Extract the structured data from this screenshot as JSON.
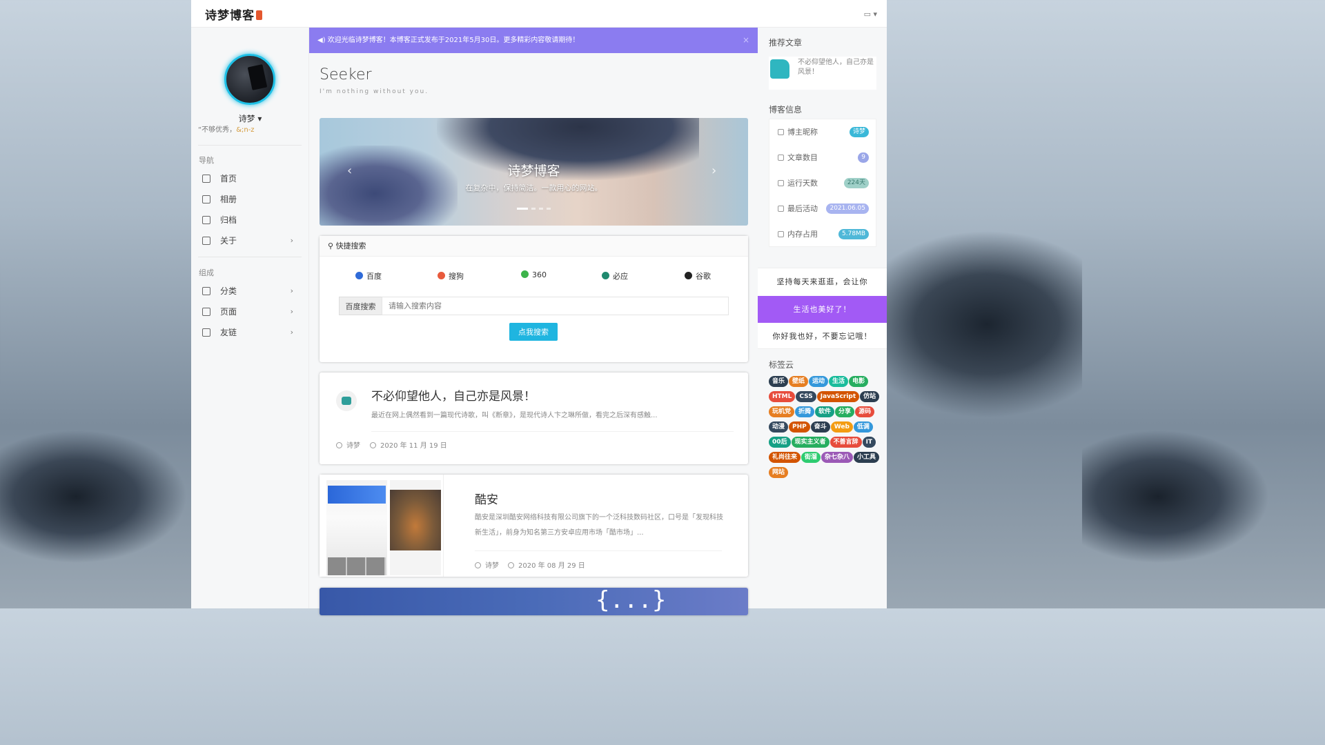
{
  "header": {
    "logo": "诗梦博客",
    "notify_icon": "message-icon"
  },
  "profile": {
    "name": "诗梦",
    "motto_prefix": "“不够优秀，",
    "motto_suffix": "&;n-z"
  },
  "nav": {
    "group1": "导航",
    "items1": [
      {
        "label": "首页",
        "icon": "home-icon"
      },
      {
        "label": "相册",
        "icon": "image-icon"
      },
      {
        "label": "归档",
        "icon": "archive-icon"
      },
      {
        "label": "关于",
        "icon": "coffee-icon",
        "chevron": true
      }
    ],
    "group2": "组成",
    "items2": [
      {
        "label": "分类",
        "icon": "grid-icon",
        "chevron": true
      },
      {
        "label": "页面",
        "icon": "file-icon",
        "chevron": true
      },
      {
        "label": "友链",
        "icon": "user-icon",
        "chevron": true
      }
    ]
  },
  "notice": {
    "text": "欢迎光临诗梦博客！本博客正式发布于2021年5月30日。更多精彩内容敬请期待！",
    "close": "×"
  },
  "page": {
    "title": "Seeker",
    "subtitle": "I'm nothing without you."
  },
  "carousel": {
    "title": "诗梦博客",
    "subtitle": "在复杂中，保持简洁。一款用心的网站。",
    "prev": "‹",
    "next": "›"
  },
  "search": {
    "heading": "快捷搜索",
    "engines": [
      {
        "label": "百度",
        "color": "#2f6bd8"
      },
      {
        "label": "搜狗",
        "color": "#e85a3c"
      },
      {
        "label": "360",
        "color": "#3cb34a"
      },
      {
        "label": "必应",
        "color": "#1f8a6f"
      },
      {
        "label": "谷歌",
        "color": "#222222"
      }
    ],
    "prefix": "百度搜索",
    "placeholder": "请输入搜索内容",
    "button": "点我搜索"
  },
  "posts": [
    {
      "title": "不必仰望他人，自己亦是风景！",
      "excerpt": "最近在网上偶然看到一篇现代诗歌，叫《断章》，是现代诗人卞之琳所做，看完之后深有感触...",
      "author": "诗梦",
      "date": "2020 年 11 月 19 日"
    },
    {
      "title": "酷安",
      "excerpt": "酷安是深圳酷安网络科技有限公司旗下的一个泛科技数码社区，口号是「发现科技新生活」，前身为知名第三方安卓应用市场「酷市场」...",
      "author": "诗梦",
      "date": "2020 年 08 月 29 日"
    }
  ],
  "post3": {
    "brace": "{...}"
  },
  "sidebar_right": {
    "recommend_heading": "推荐文章",
    "recommend_title": "不必仰望他人，自己亦是风景！",
    "info_heading": "博客信息",
    "info": [
      {
        "label": "博主昵称",
        "value": "诗梦",
        "color": "#3ab8d8"
      },
      {
        "label": "文章数目",
        "value": "9",
        "color": "#9aa6e8"
      },
      {
        "label": "运行天数",
        "value": "224天",
        "color": "#9fd0c8"
      },
      {
        "label": "最后活动",
        "value": "2021.06.05",
        "color": "#a8b4f0"
      },
      {
        "label": "内存占用",
        "value": "5.78MB",
        "color": "#4fb8d8"
      }
    ],
    "motivation": [
      "坚持每天来逛逛，会让你",
      "生活也美好了！",
      "你好我也好，不要忘记哦！"
    ],
    "tags_heading": "标签云",
    "tags": [
      {
        "label": "音乐",
        "color": "#2c3e50"
      },
      {
        "label": "壁纸",
        "color": "#e67e22"
      },
      {
        "label": "运动",
        "color": "#3498db"
      },
      {
        "label": "生活",
        "color": "#1abc9c"
      },
      {
        "label": "电影",
        "color": "#27ae60"
      },
      {
        "label": "HTML",
        "color": "#e74c3c"
      },
      {
        "label": "CSS",
        "color": "#34495e"
      },
      {
        "label": "JavaScript",
        "color": "#d35400"
      },
      {
        "label": "仿站",
        "color": "#2c3e50"
      },
      {
        "label": "玩机党",
        "color": "#e67e22"
      },
      {
        "label": "折腾",
        "color": "#3498db"
      },
      {
        "label": "软件",
        "color": "#16a085"
      },
      {
        "label": "分享",
        "color": "#27ae60"
      },
      {
        "label": "源码",
        "color": "#e74c3c"
      },
      {
        "label": "动漫",
        "color": "#34495e"
      },
      {
        "label": "PHP",
        "color": "#d35400"
      },
      {
        "label": "奋斗",
        "color": "#2c3e50"
      },
      {
        "label": "Web",
        "color": "#f39c12"
      },
      {
        "label": "低调",
        "color": "#3498db"
      },
      {
        "label": "00后",
        "color": "#16a085"
      },
      {
        "label": "现实主义者",
        "color": "#27ae60"
      },
      {
        "label": "不善言辞",
        "color": "#e74c3c"
      },
      {
        "label": "IT",
        "color": "#34495e"
      },
      {
        "label": "礼尚往来",
        "color": "#d35400"
      },
      {
        "label": "街溜",
        "color": "#2ecc71"
      },
      {
        "label": "杂七杂八",
        "color": "#9b59b6"
      },
      {
        "label": "小工具",
        "color": "#2c3e50"
      },
      {
        "label": "网站",
        "color": "#e67e22"
      }
    ]
  }
}
